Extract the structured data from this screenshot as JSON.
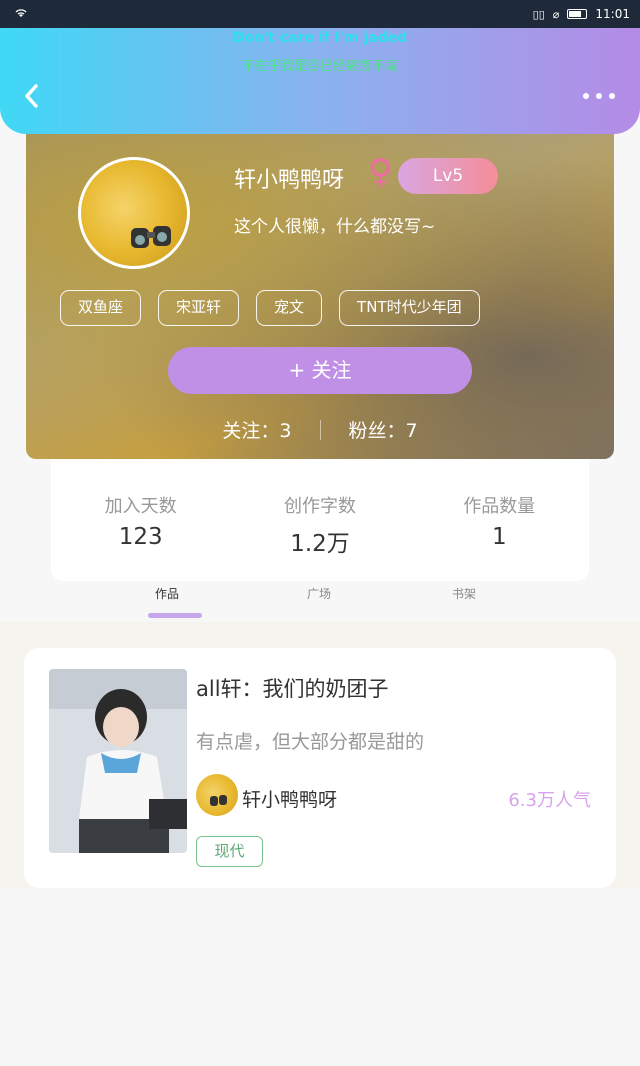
{
  "status_bar": {
    "time": "11:01"
  },
  "header": {
    "lyric_en": "Don't care if I'm jaded",
    "lyric_zh": "不在乎我是否已经疲惫不堪",
    "back_icon": "‹",
    "more_icon": "•••"
  },
  "profile": {
    "username": "轩小鸭鸭呀",
    "gender_symbol": "♀",
    "level": "Lv5",
    "bio": "这个人很懒，什么都没写~",
    "tags": [
      "双鱼座",
      "宋亚轩",
      "宠文",
      "TNT时代少年团"
    ],
    "follow_button": "+  关注",
    "following": "关注：3",
    "followers": "粉丝：7"
  },
  "stats": [
    {
      "label": "加入天数",
      "value": "123"
    },
    {
      "label": "创作字数",
      "value": "1.2万"
    },
    {
      "label": "作品数量",
      "value": "1"
    }
  ],
  "tabs": [
    {
      "label": "作品",
      "active": true
    },
    {
      "label": "广场",
      "active": false
    },
    {
      "label": "书架",
      "active": false
    }
  ],
  "works": [
    {
      "title": "all轩：我们的奶团子",
      "description": "有点虐，但大部分都是甜的",
      "author": "轩小鸭鸭呀",
      "popularity": "6.3万人气",
      "genre": "现代"
    }
  ],
  "colors": {
    "accent": "#c08fe6",
    "header_start": "#3fd8f5",
    "header_end": "#b48be6",
    "popularity": "#d7a4ea",
    "genre_tag": "#7cc28f"
  }
}
